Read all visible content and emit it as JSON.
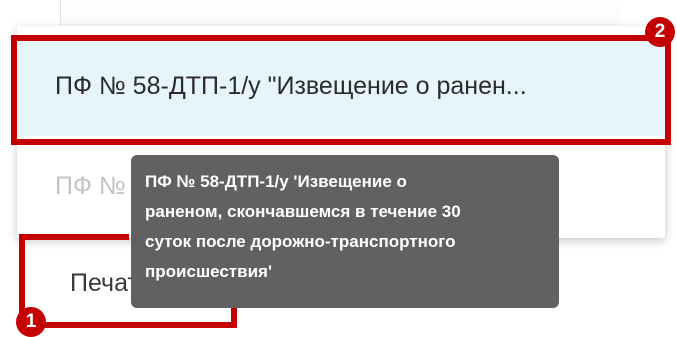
{
  "menu": {
    "items": [
      {
        "label": "ПФ № 58-ДТП-1/у \"Извещение о ранен..."
      },
      {
        "label": "ПФ № 58-ДТП-1/у \"Извещение о ранен..."
      }
    ]
  },
  "tooltip": {
    "lines": [
      "ПФ № 58-ДТП-1/у 'Извещение о",
      "раненом, скончавшемся в течение 30",
      "суток после дорожно-транспортного",
      "происшествия'"
    ]
  },
  "print_button": {
    "label": "Печать"
  },
  "annotations": {
    "badge_1": "1",
    "badge_2": "2"
  },
  "colors": {
    "highlight": "#c40000",
    "selected_bg": "#e6f4fb",
    "tooltip_bg": "#616161"
  }
}
